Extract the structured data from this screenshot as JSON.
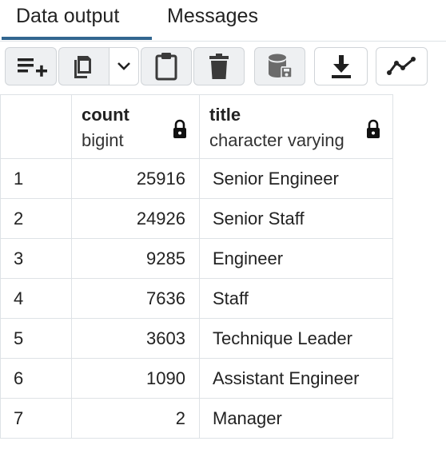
{
  "tabs": [
    "Data output",
    "Messages"
  ],
  "toolbar": {
    "buttons": [
      {
        "icon": "add-row-icon"
      },
      {
        "icon": "copy-icon"
      },
      {
        "icon": "chevron-down-icon"
      },
      {
        "icon": "paste-icon"
      },
      {
        "icon": "delete-icon"
      },
      {
        "icon": "save-data-icon"
      },
      {
        "icon": "download-icon"
      },
      {
        "icon": "graph-visualiser-icon"
      }
    ]
  },
  "columns": [
    {
      "name": "count",
      "type": "bigint"
    },
    {
      "name": "title",
      "type": "character varying"
    }
  ],
  "rows": [
    {
      "n": "1",
      "count": "25916",
      "title": "Senior Engineer"
    },
    {
      "n": "2",
      "count": "24926",
      "title": "Senior Staff"
    },
    {
      "n": "3",
      "count": "9285",
      "title": "Engineer"
    },
    {
      "n": "4",
      "count": "7636",
      "title": "Staff"
    },
    {
      "n": "5",
      "count": "3603",
      "title": "Technique Leader"
    },
    {
      "n": "6",
      "count": "1090",
      "title": "Assistant Engineer"
    },
    {
      "n": "7",
      "count": "2",
      "title": "Manager"
    }
  ]
}
